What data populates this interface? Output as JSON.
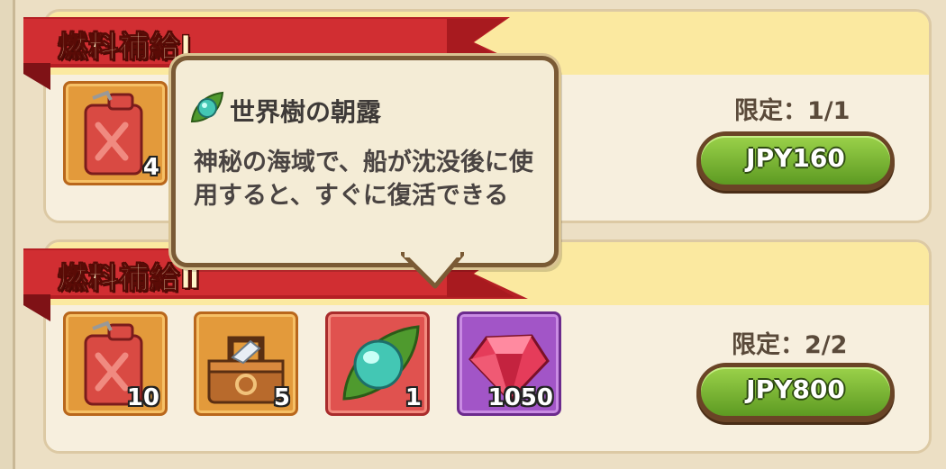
{
  "packs": [
    {
      "title": "燃料補給Ⅰ",
      "limit": "限定：1/1",
      "price": "JPY160",
      "items": [
        {
          "icon": "fuel-can-icon",
          "count": "4"
        }
      ]
    },
    {
      "title": "燃料補給Ⅱ",
      "limit": "限定：2/2",
      "price": "JPY800",
      "items": [
        {
          "icon": "fuel-can-icon",
          "count": "10"
        },
        {
          "icon": "toolbox-icon",
          "count": "5"
        },
        {
          "icon": "dew-gem-icon",
          "count": "1"
        },
        {
          "icon": "ruby-gem-icon",
          "count": "1050"
        }
      ]
    }
  ],
  "tooltip": {
    "icon": "dew-gem-icon",
    "name": "世界樹の朝露",
    "description": "神秘の海域で、船が沈没後に使用すると、すぐに復活できる"
  },
  "colors": {
    "ribbon": "#c8262b",
    "button": "#7cbf35",
    "band": "#fbe9a0"
  }
}
